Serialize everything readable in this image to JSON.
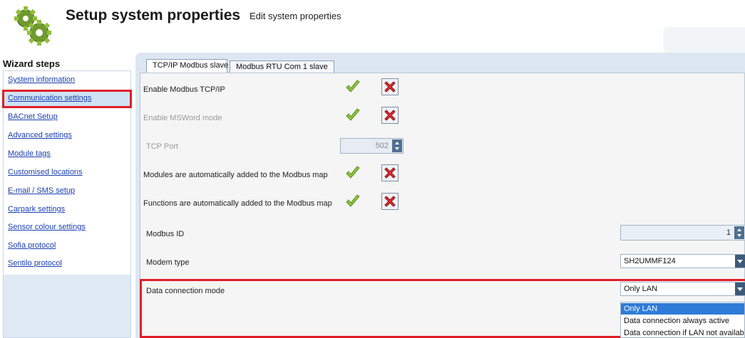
{
  "header": {
    "title": "Setup system properties",
    "subtitle": "Edit system properties",
    "logo_icon": "gears-icon"
  },
  "wizard": {
    "title": "Wizard steps",
    "selected_index": 1,
    "items": [
      {
        "label": "System information"
      },
      {
        "label": "Communication settings"
      },
      {
        "label": "BACnet Setup"
      },
      {
        "label": "Advanced settings"
      },
      {
        "label": "Module tags"
      },
      {
        "label": "Customised locations"
      },
      {
        "label": "E-mail / SMS setup"
      },
      {
        "label": "Carpark settings"
      },
      {
        "label": "Sensor colour settings"
      },
      {
        "label": "Sofia protocol"
      },
      {
        "label": "Sentilo protocol"
      }
    ]
  },
  "tabs": [
    {
      "label": "TCP/IP Modbus slave",
      "active": true
    },
    {
      "label": "Modbus RTU Com 1 slave",
      "active": false
    }
  ],
  "settings": {
    "enable_tcpip": {
      "label": "Enable Modbus TCP/IP"
    },
    "enable_msword": {
      "label": "Enable MSWord mode"
    },
    "tcp_port": {
      "label": "TCP Port",
      "value": "502"
    },
    "modules_auto": {
      "label": "Modules are automatically added to the Modbus map"
    },
    "functions_auto": {
      "label": "Functions are automatically added to the Modbus map"
    },
    "modbus_id": {
      "label": "Modbus ID",
      "value": "1"
    },
    "modem_type": {
      "label": "Modem type",
      "value": "SH2UMMF124"
    },
    "data_connection": {
      "label": "Data connection mode",
      "value": "Only LAN",
      "options": [
        "Only LAN",
        "Data connection always active",
        "Data connection if LAN not availabl"
      ]
    }
  },
  "colors": {
    "highlight_red": "#e01f26",
    "link_blue": "#1a3fb0",
    "panel_blue": "#dce7f2",
    "selected_option": "#2f7bd8"
  }
}
